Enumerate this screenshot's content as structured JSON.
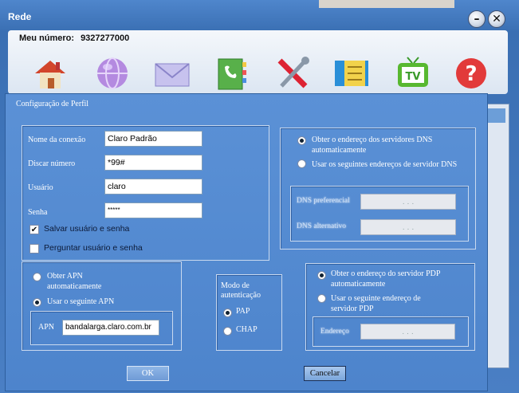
{
  "window": {
    "title": "Rede",
    "number_label": "Meu número:",
    "number_value": "9327277000",
    "minimize_label": "–",
    "close_label": "✕",
    "toolbar_icons": [
      "home-icon",
      "globe-icon",
      "mail-icon",
      "phonebook-icon",
      "tools-icon",
      "sim-card-icon",
      "tv-icon",
      "help-icon"
    ]
  },
  "dialog": {
    "title": "Configuração de Perfil",
    "fields": {
      "connection_name": {
        "label": "Nome da conexão",
        "value": "Claro Padrão"
      },
      "dial_number": {
        "label": "Discar número",
        "value": "*99#"
      },
      "user": {
        "label": "Usuário",
        "value": "claro"
      },
      "password": {
        "label": "Senha",
        "value": "*****"
      }
    },
    "save_user_pass": {
      "label": "Salvar usuário e senha",
      "checked": true
    },
    "ask_user_pass": {
      "label": "Perguntar usuário e senha",
      "checked": false
    },
    "dns": {
      "auto_label": "Obter o endereço dos servidores DNS automaticamente",
      "manual_label": "Usar os seguintes endereços de servidor DNS",
      "selected": "auto",
      "preferred_label": "DNS preferencial",
      "alternate_label": "DNS alternativo",
      "preferred_value": ".     .     .",
      "alternate_value": ".     .     ."
    },
    "apn": {
      "auto_label": "Obter APN automaticamente",
      "manual_label": "Usar o seguinte APN",
      "selected": "manual",
      "field_label": "APN",
      "value": "bandalarga.claro.com.br"
    },
    "auth": {
      "title": "Modo de autenticação",
      "options": [
        "PAP",
        "CHAP"
      ],
      "selected": "PAP"
    },
    "pdp": {
      "auto_label": "Obter o endereço do servidor PDP automaticamente",
      "manual_label": "Usar o seguinte endereço de servidor PDP",
      "selected": "auto",
      "address_label": "Endereço",
      "address_value": ".     .     ."
    },
    "ok_label": "OK",
    "cancel_label": "Cancelar"
  }
}
